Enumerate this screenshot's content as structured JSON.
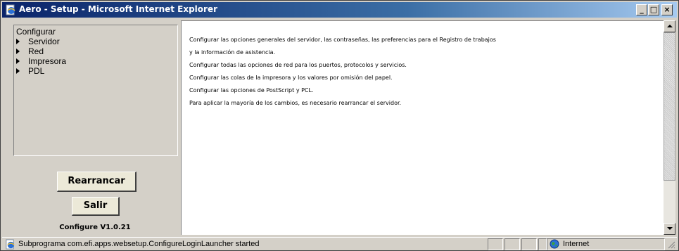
{
  "window": {
    "title": "Aero - Setup - Microsoft Internet Explorer",
    "controls": {
      "minimize": "_",
      "maximize": "□",
      "close": "×"
    }
  },
  "sidebar": {
    "root_label": "Configurar",
    "items": [
      {
        "label": "Servidor"
      },
      {
        "label": "Red"
      },
      {
        "label": "Impresora"
      },
      {
        "label": "PDL"
      }
    ],
    "restart_label": "Rearrancar",
    "exit_label": "Salir",
    "version": "Configure V1.0.21"
  },
  "content": {
    "lines": [
      "Configurar las opciones generales del servidor, las contraseñas, las preferencias para el Registro de trabajos",
      "y la información de asistencia.",
      "Configurar todas las opciones de red para los puertos, protocolos y servicios.",
      "Configurar las colas de la impresora y los valores por omisión del papel.",
      "Configurar las opciones de PostScript y PCL.",
      "Para aplicar la mayoría de los cambios, es necesario rearrancar el servidor."
    ]
  },
  "statusbar": {
    "text": "Subprograma com.efi.apps.websetup.ConfigureLoginLauncher started",
    "zone": "Internet"
  },
  "icons": {
    "app": "ie-page-icon",
    "status": "ie-page-icon",
    "zone": "globe-icon"
  },
  "colors": {
    "titlebar_start": "#0a246a",
    "titlebar_end": "#a6caf0",
    "chrome": "#d4d0c8",
    "button_face": "#ece9d8"
  }
}
